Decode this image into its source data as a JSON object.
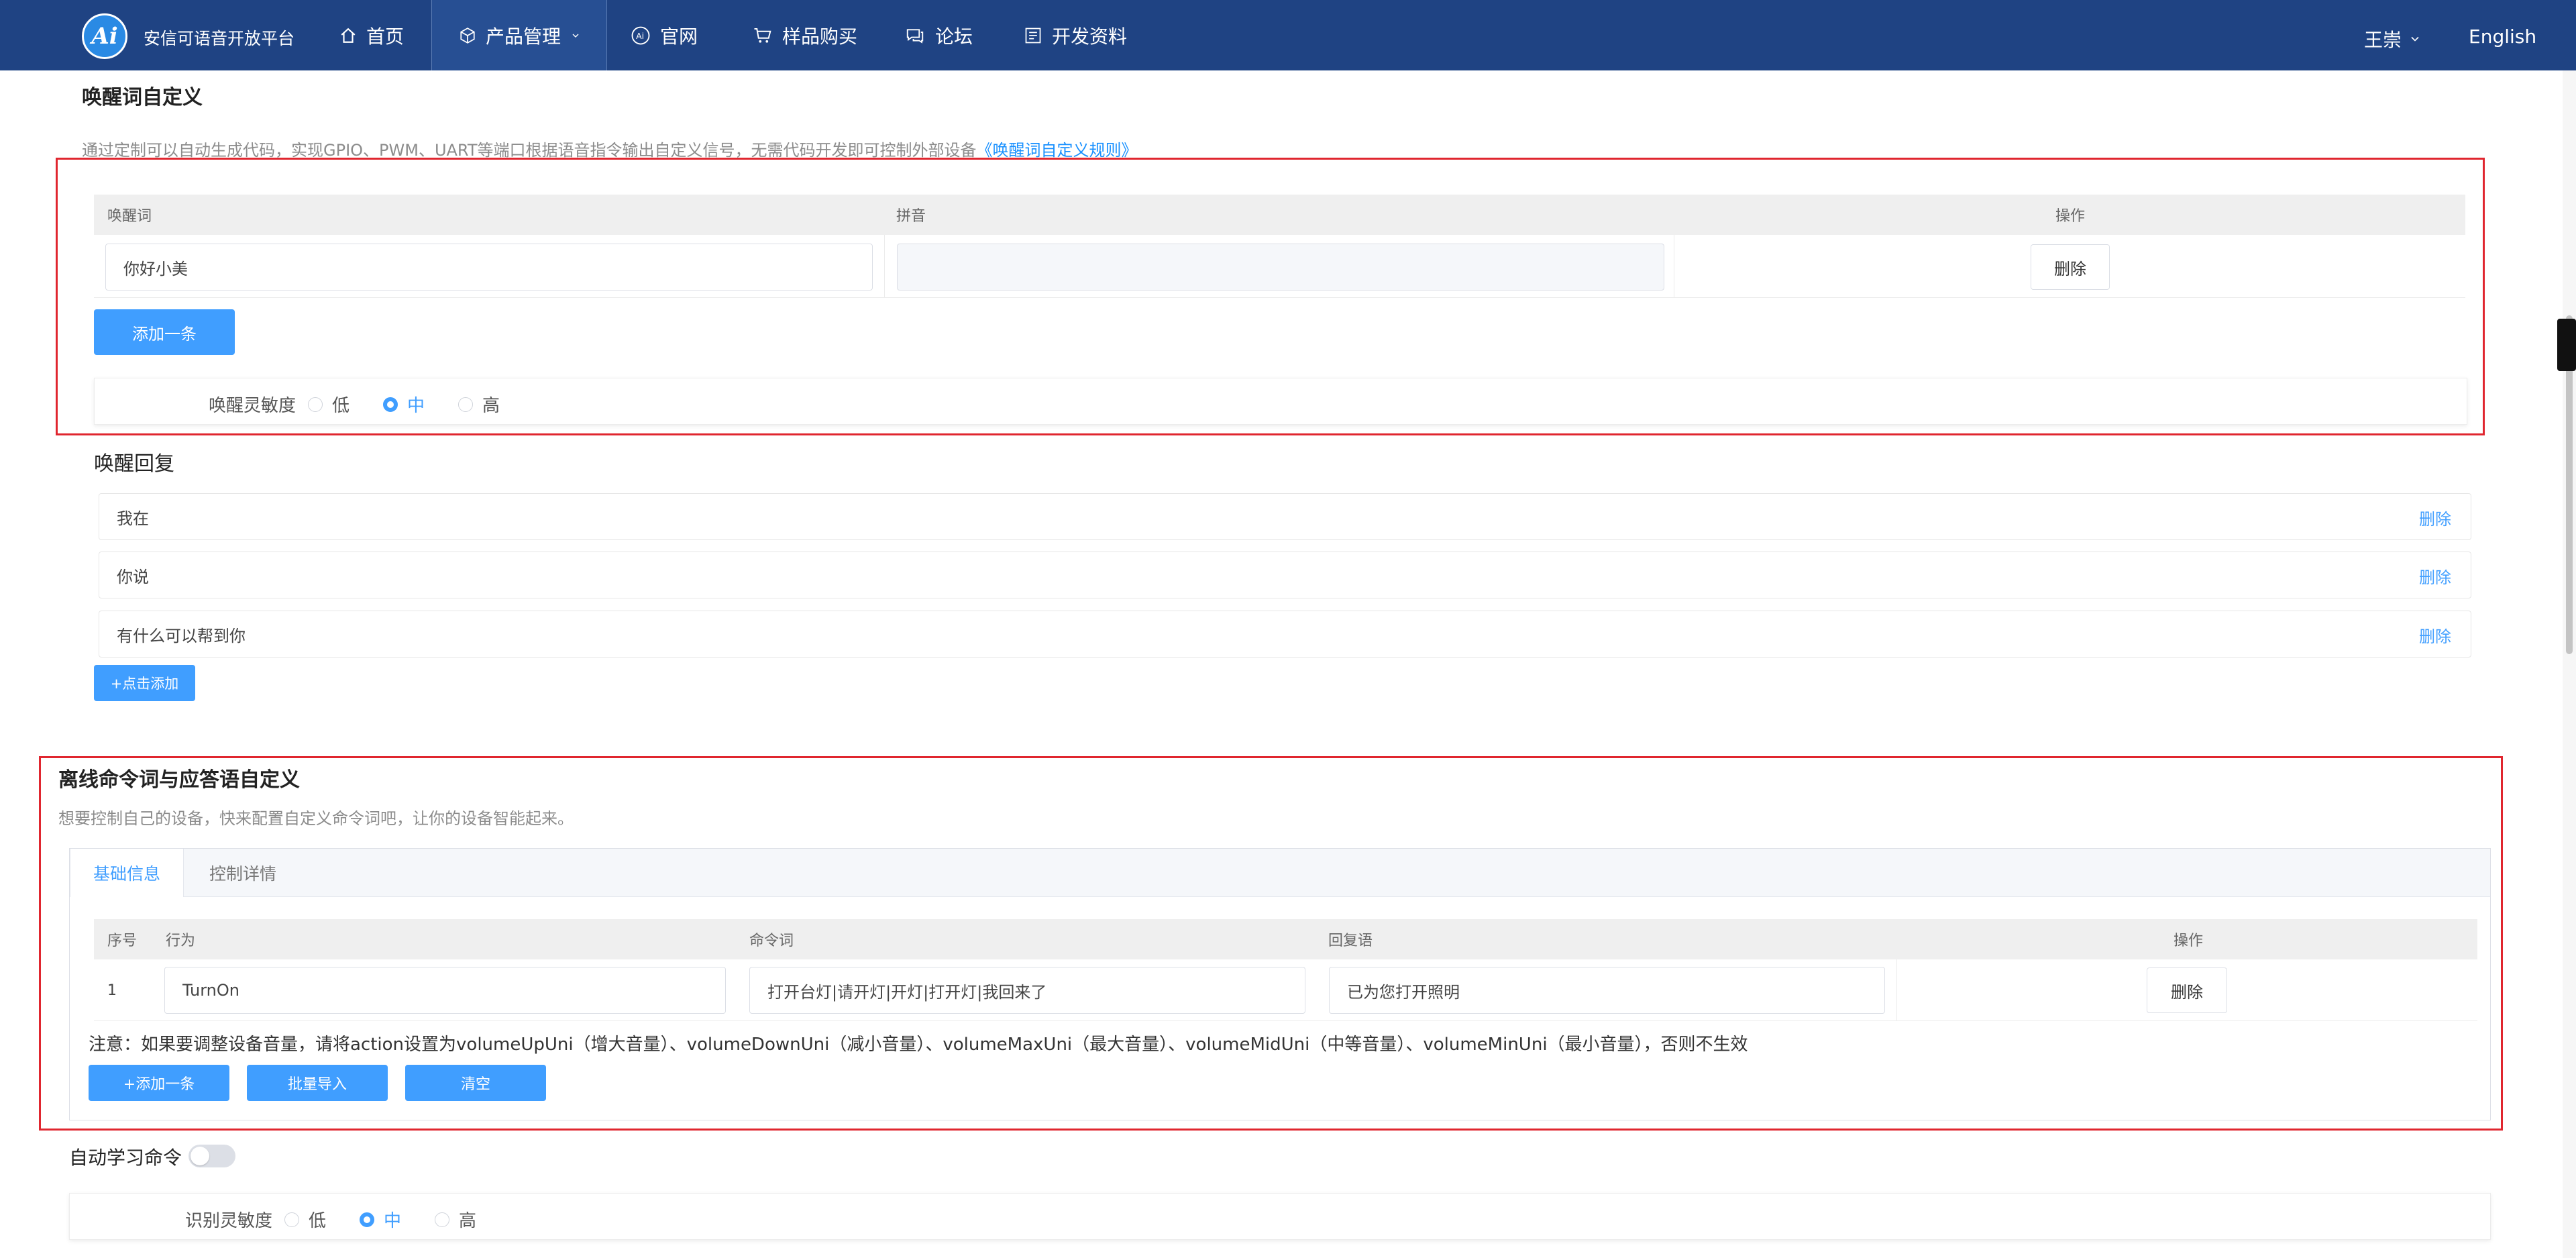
{
  "colors": {
    "nav_bg": "#1f4383",
    "accent": "#409eff",
    "highlight_frame": "#e0262f"
  },
  "nav": {
    "logo_text": "安信可语音开放平台",
    "logo_mark": "Ai",
    "items": [
      {
        "label": "首页",
        "icon": "home-icon"
      },
      {
        "label": "产品管理",
        "icon": "cube-icon"
      },
      {
        "label": "官网",
        "icon": "ai-icon"
      },
      {
        "label": "样品购买",
        "icon": "cart-icon"
      },
      {
        "label": "论坛",
        "icon": "chat-icon"
      },
      {
        "label": "开发资料",
        "icon": "document-icon"
      }
    ],
    "user": "王崇",
    "language": "English"
  },
  "wake": {
    "title": "唤醒词自定义",
    "desc": "通过定制可以自动生成代码，实现GPIO、PWM、UART等端口根据语音指令输出自定义信号，无需代码开发即可控制外部设备",
    "rule_link": "《唤醒词自定义规则》",
    "table_headers": [
      "唤醒词",
      "拼音",
      "操作"
    ],
    "rows": [
      {
        "word": "你好小美",
        "pinyin": "",
        "action": "删除"
      }
    ],
    "add_button": "添加一条",
    "sensitivity_label": "唤醒灵敏度",
    "sensitivity_options": [
      "低",
      "中",
      "高"
    ],
    "sensitivity_selected": "中"
  },
  "reply": {
    "title": "唤醒回复",
    "items": [
      "我在",
      "你说",
      "有什么可以帮到你"
    ],
    "delete_label": "删除",
    "add_button": "+点击添加"
  },
  "offline": {
    "title": "离线命令词与应答语自定义",
    "desc": "想要控制自己的设备，快来配置自定义命令词吧，让你的设备智能起来。",
    "tabs": [
      "基础信息",
      "控制详情"
    ],
    "active_tab": "基础信息",
    "table_headers": [
      "序号",
      "行为",
      "命令词",
      "回复语",
      "操作"
    ],
    "rows": [
      {
        "index": "1",
        "action": "TurnOn",
        "command": "打开台灯|请开灯|开灯|打开灯|我回来了",
        "reply": "已为您打开照明",
        "op": "删除"
      }
    ],
    "note": "注意：如果要调整设备音量，请将action设置为volumeUpUni（增大音量）、volumeDownUni（减小音量）、volumeMaxUni（最大音量）、volumeMidUni（中等音量）、volumeMinUni（最小音量），否则不生效",
    "buttons": [
      "+添加一条",
      "批量导入",
      "清空"
    ]
  },
  "auto_learn": {
    "label": "自动学习命令",
    "enabled": false
  },
  "recognition": {
    "sensitivity_label": "识别灵敏度",
    "options": [
      "低",
      "中",
      "高"
    ],
    "selected": "中"
  }
}
